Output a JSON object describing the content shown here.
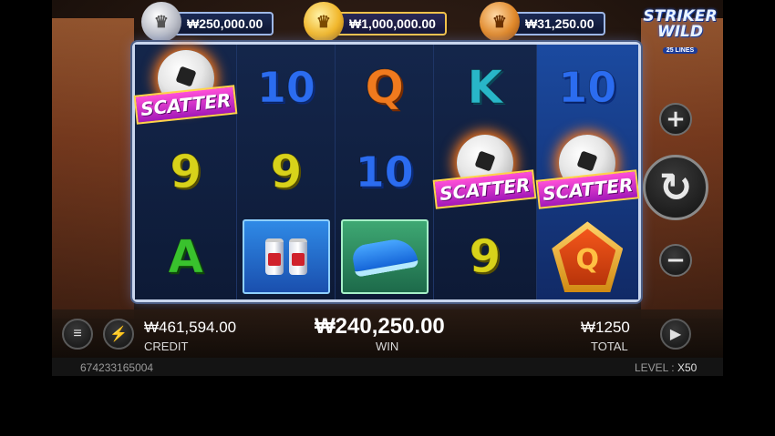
{
  "jackpots": {
    "silver": "₩250,000.00",
    "gold": "₩1,000,000.00",
    "bronze": "₩31,250.00"
  },
  "logo": {
    "line1": "STRIKER",
    "line2": "WILD",
    "line3": "25 LINES"
  },
  "reels": [
    {
      "symbols": [
        "SCATTER",
        "9",
        "A"
      ]
    },
    {
      "symbols": [
        "10",
        "9",
        "drinks"
      ]
    },
    {
      "symbols": [
        "Q",
        "10",
        "boot"
      ]
    },
    {
      "symbols": [
        "K",
        "SCATTER",
        "9"
      ]
    },
    {
      "symbols": [
        "10",
        "SCATTER",
        "Q-badge"
      ]
    }
  ],
  "scatter_label": "SCATTER",
  "sym": {
    "ten": "10",
    "nine": "9",
    "q": "Q",
    "k": "K",
    "a": "A"
  },
  "controls": {
    "plus": "+",
    "minus": "−",
    "spin": "↻",
    "menu": "≡",
    "turbo": "⚡",
    "auto": "▶"
  },
  "stats": {
    "credit_value": "₩461,594.00",
    "credit_label": "CREDIT",
    "win_value": "₩240,250.00",
    "win_label": "WIN",
    "total_value": "₩1250",
    "total_label": "TOTAL"
  },
  "footer": {
    "round_id": "674233165004",
    "level_label": "LEVEL",
    "level_value": "X50"
  }
}
